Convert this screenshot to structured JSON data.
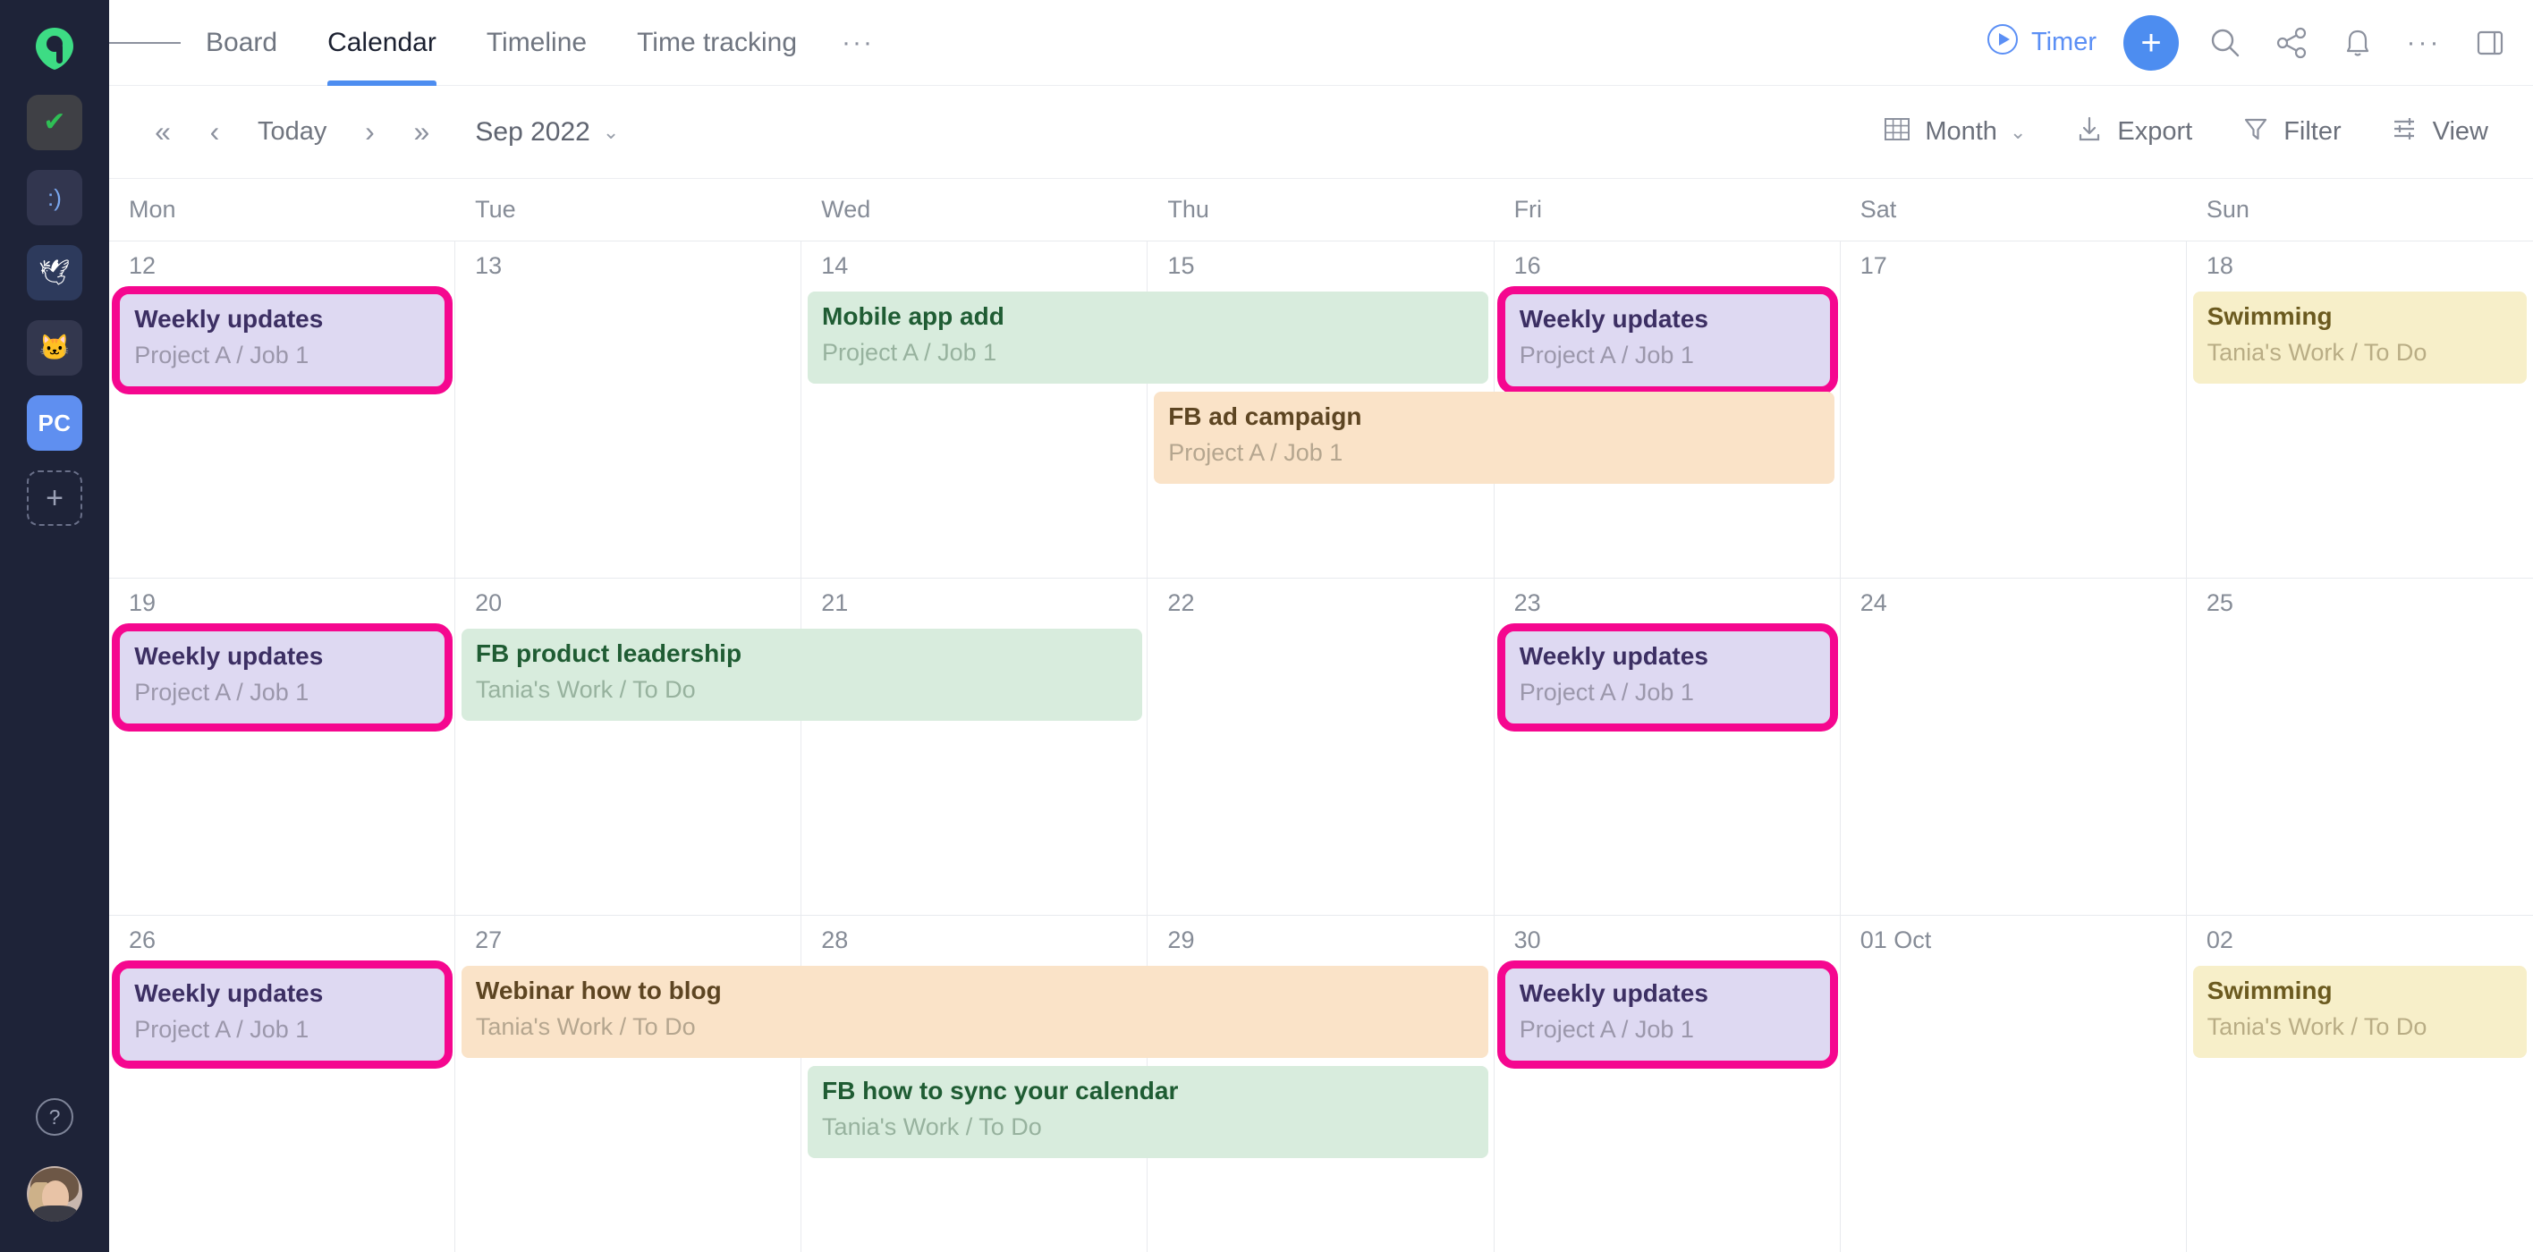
{
  "rail": {
    "logo_icon": "company-logo-icon",
    "workspaces": [
      {
        "id": "check",
        "glyph": "✔",
        "name": "workspace-check"
      },
      {
        "id": "smile",
        "glyph": ":)",
        "name": "workspace-smile"
      },
      {
        "id": "bird",
        "glyph": "🕊",
        "name": "workspace-bird"
      },
      {
        "id": "cat",
        "glyph": "🐱",
        "name": "workspace-cat"
      },
      {
        "id": "pc",
        "glyph": "PC",
        "name": "workspace-pc"
      }
    ],
    "add_label": "+",
    "help_label": "?",
    "avatar_label": ""
  },
  "header": {
    "menu_icon": "hamburger-icon",
    "tabs": [
      {
        "label": "Board",
        "active": false
      },
      {
        "label": "Calendar",
        "active": true
      },
      {
        "label": "Timeline",
        "active": false
      },
      {
        "label": "Time tracking",
        "active": false
      }
    ],
    "tabs_more": "···",
    "timer_label": "Timer",
    "add_label": "+",
    "icons": [
      "search-icon",
      "share-icon",
      "bell-icon",
      "more-icon",
      "panel-toggle-icon"
    ],
    "accent_color": "#4d8df0"
  },
  "toolbar": {
    "nav_first": "«",
    "nav_prev": "‹",
    "today_label": "Today",
    "nav_next": "›",
    "nav_last": "»",
    "period_label": "Sep 2022",
    "view_mode": "Month",
    "export_label": "Export",
    "filter_label": "Filter",
    "view_label": "View"
  },
  "calendar": {
    "day_headers": [
      "Mon",
      "Tue",
      "Wed",
      "Thu",
      "Fri",
      "Sat",
      "Sun"
    ],
    "selection_color": "#f5078f",
    "weeks": [
      {
        "days": [
          "12",
          "13",
          "14",
          "15",
          "16",
          "17",
          "18"
        ],
        "events": [
          {
            "title": "Weekly updates",
            "sub": "Project A / Job 1",
            "color": "purple",
            "start": 0,
            "span": 1,
            "row": 0,
            "selected": true
          },
          {
            "title": "Mobile app add",
            "sub": "Project A / Job 1",
            "color": "green",
            "start": 2,
            "span": 2,
            "row": 0,
            "selected": false
          },
          {
            "title": "Weekly updates",
            "sub": "Project A / Job 1",
            "color": "purple",
            "start": 4,
            "span": 1,
            "row": 0,
            "selected": true
          },
          {
            "title": "Swimming",
            "sub": "Tania's Work / To Do",
            "color": "yellow",
            "start": 6,
            "span": 1,
            "row": 0,
            "selected": false
          },
          {
            "title": "FB ad campaign",
            "sub": "Project A / Job 1",
            "color": "orange",
            "start": 3,
            "span": 2,
            "row": 1,
            "selected": false
          }
        ]
      },
      {
        "days": [
          "19",
          "20",
          "21",
          "22",
          "23",
          "24",
          "25"
        ],
        "events": [
          {
            "title": "Weekly updates",
            "sub": "Project A / Job 1",
            "color": "purple",
            "start": 0,
            "span": 1,
            "row": 0,
            "selected": true
          },
          {
            "title": "FB product leadership",
            "sub": "Tania's Work / To Do",
            "color": "green",
            "start": 1,
            "span": 2,
            "row": 0,
            "selected": false
          },
          {
            "title": "Weekly updates",
            "sub": "Project A / Job 1",
            "color": "purple",
            "start": 4,
            "span": 1,
            "row": 0,
            "selected": true
          }
        ]
      },
      {
        "days": [
          "26",
          "27",
          "28",
          "29",
          "30",
          "01 Oct",
          "02"
        ],
        "events": [
          {
            "title": "Weekly updates",
            "sub": "Project A / Job 1",
            "color": "purple",
            "start": 0,
            "span": 1,
            "row": 0,
            "selected": true
          },
          {
            "title": "Webinar how to blog",
            "sub": "Tania's Work / To Do",
            "color": "orange",
            "start": 1,
            "span": 3,
            "row": 0,
            "selected": false
          },
          {
            "title": "Weekly updates",
            "sub": "Project A / Job 1",
            "color": "purple",
            "start": 4,
            "span": 1,
            "row": 0,
            "selected": true
          },
          {
            "title": "Swimming",
            "sub": "Tania's Work / To Do",
            "color": "yellow",
            "start": 6,
            "span": 1,
            "row": 0,
            "selected": false
          },
          {
            "title": "FB how to sync your calendar",
            "sub": "Tania's Work / To Do",
            "color": "green",
            "start": 2,
            "span": 2,
            "row": 1,
            "selected": false
          }
        ]
      }
    ]
  }
}
